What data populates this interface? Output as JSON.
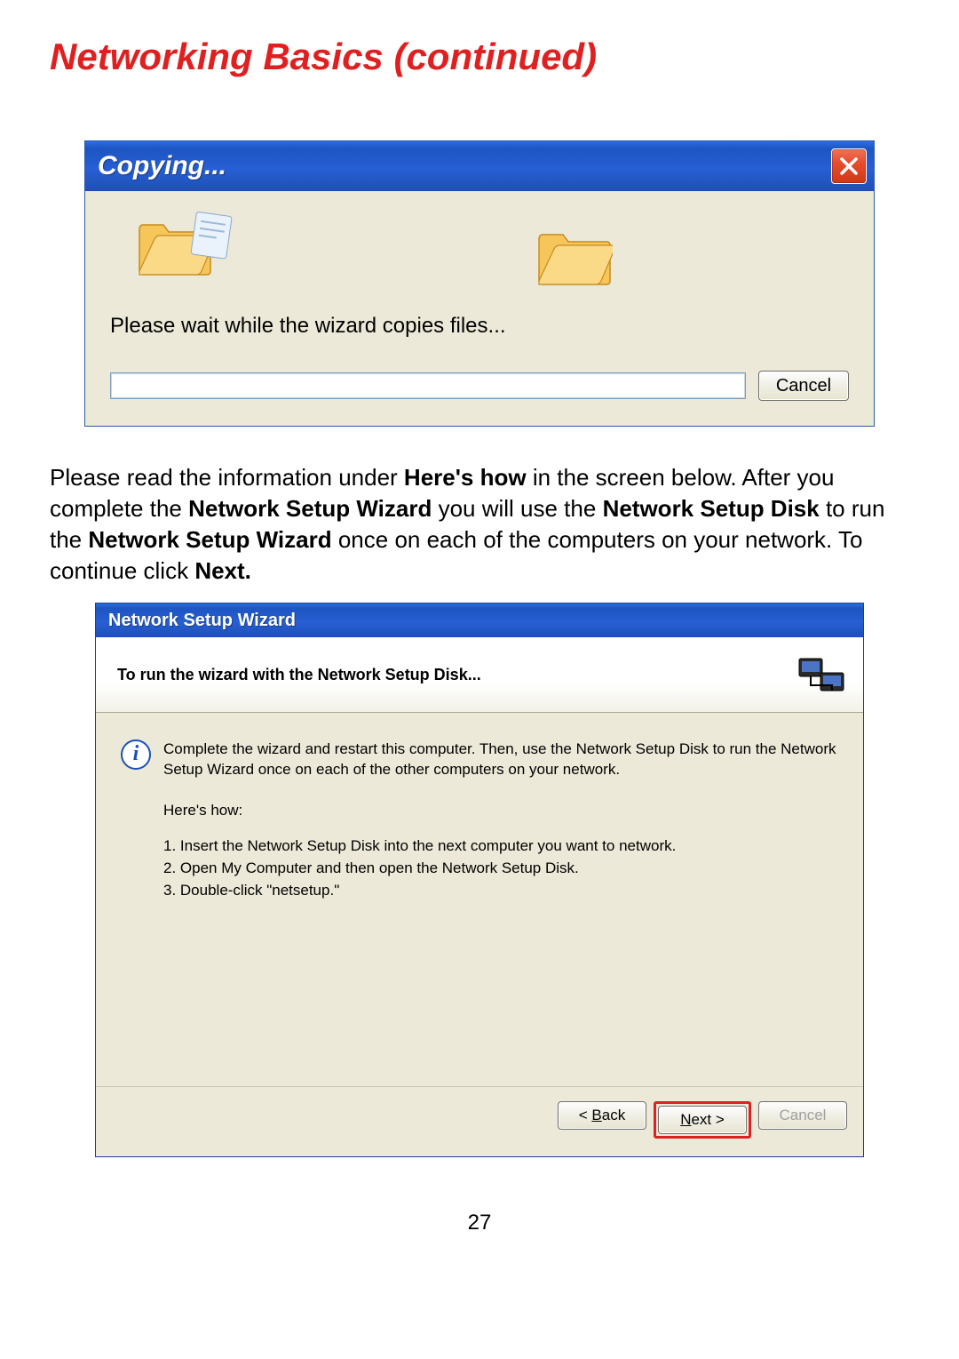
{
  "page": {
    "title": "Networking Basics (continued)",
    "number": "27"
  },
  "copying_dialog": {
    "title": "Copying...",
    "message": "Please wait while the wizard copies files...",
    "cancel_label": "Cancel"
  },
  "paragraph": {
    "t1": "Please read the information under ",
    "b1": "Here's how",
    "t2": " in the screen below. After you complete the ",
    "b2": "Network Setup Wizard",
    "t3": " you will use the ",
    "b3": "Network Setup Disk",
    "t4": " to run the ",
    "b4": "Network Setup Wizard",
    "t5": " once on each of the computers on your network. To continue click ",
    "b5": "Next."
  },
  "wizard_dialog": {
    "title": "Network Setup Wizard",
    "header": "To run the wizard with the Network Setup Disk...",
    "info_text": "Complete the wizard and restart this computer. Then, use the Network Setup Disk to run the Network Setup Wizard once on each of the other computers on your network.",
    "heres_how": "Here's how:",
    "steps": [
      "1.  Insert the Network Setup Disk into the next computer you want to network.",
      "2.  Open My Computer and then open the Network Setup Disk.",
      "3.  Double-click \"netsetup.\""
    ],
    "back_label": "< Back",
    "next_label": "Next >",
    "cancel_label": "Cancel"
  }
}
